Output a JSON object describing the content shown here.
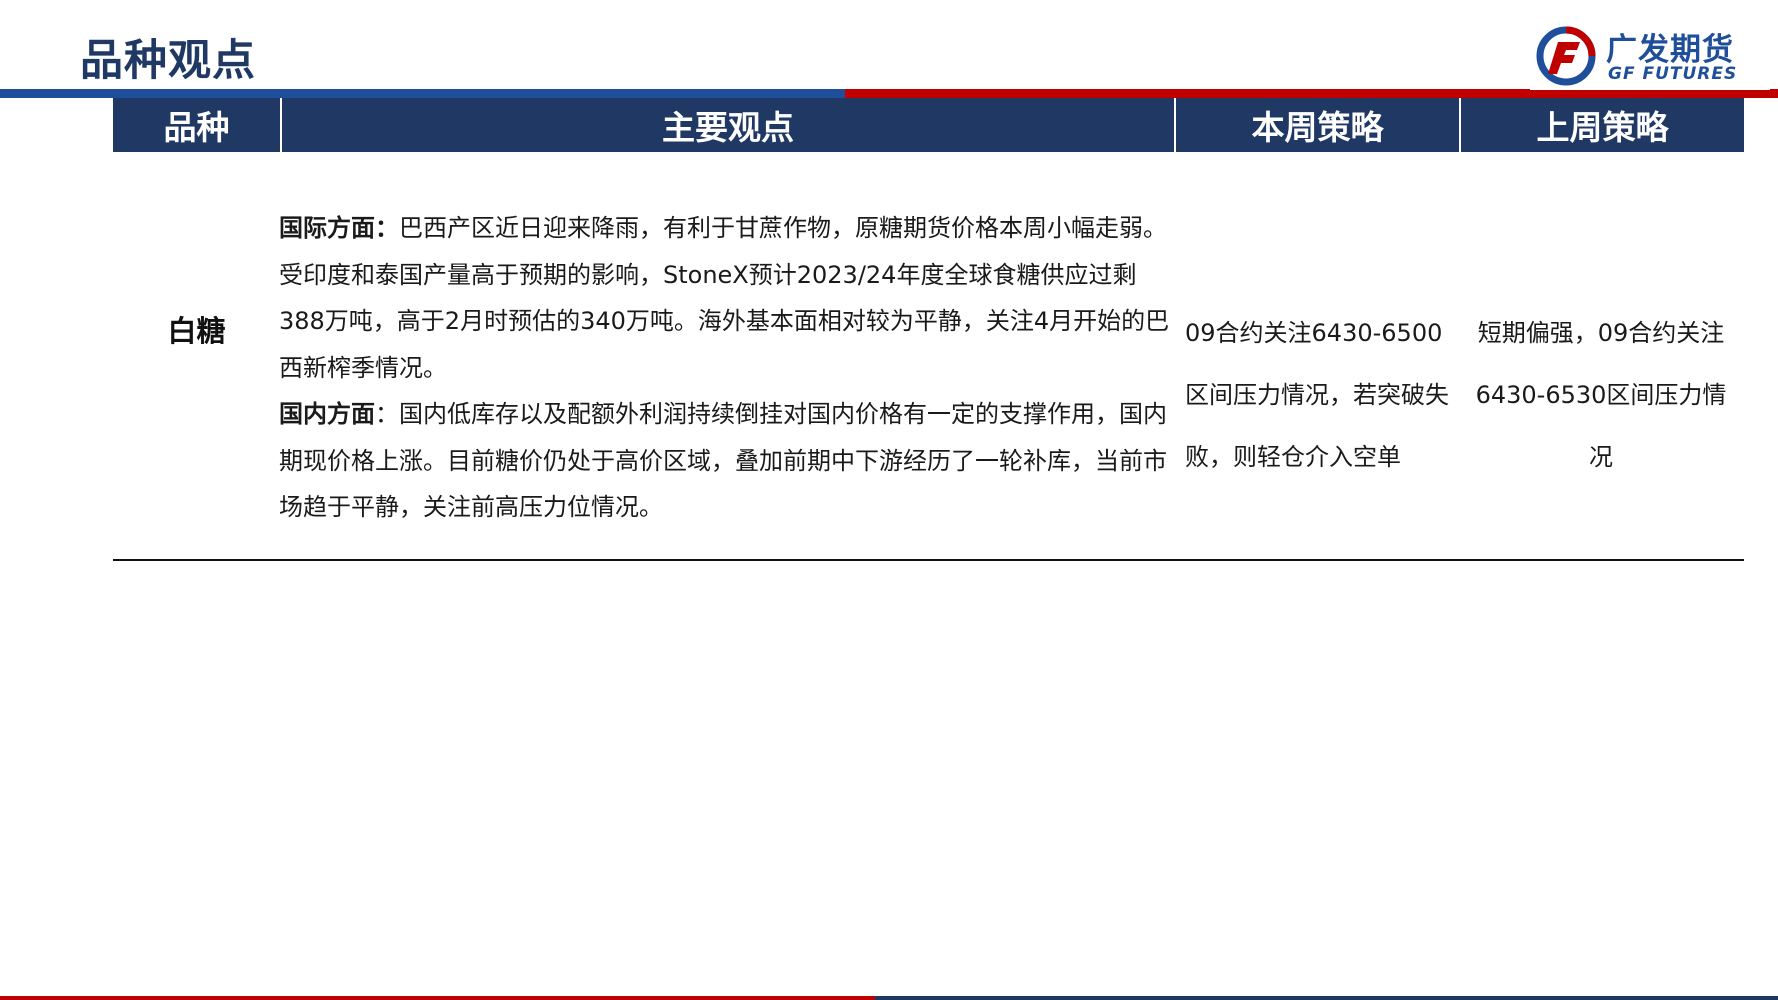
{
  "page": {
    "title": "品种观点"
  },
  "brand": {
    "name_cn": "广发期货",
    "name_en": "GF FUTURES",
    "colors": {
      "navy": "#1f3864",
      "blue": "#1f4e9a",
      "red": "#c00000"
    },
    "icon": "gf-logo-icon"
  },
  "table": {
    "headers": [
      "品种",
      "主要观点",
      "本周策略",
      "上周策略"
    ],
    "rows": [
      {
        "variety": "白糖",
        "views": {
          "international_label": "国际方面：",
          "international_text": "巴西产区近日迎来降雨，有利于甘蔗作物，原糖期货价格本周小幅走弱。受印度和泰国产量高于预期的影响，StoneX预计2023/24年度全球食糖供应过剩388万吨，高于2月时预估的340万吨。海外基本面相对较为平静，关注4月开始的巴西新榨季情况。",
          "domestic_label": "国内方面",
          "domestic_text": "：国内低库存以及配额外利润持续倒挂对国内价格有一定的支撑作用，国内期现价格上涨。目前糖价仍处于高价区域，叠加前期中下游经历了一轮补库，当前市场趋于平静，关注前高压力位情况。"
        },
        "this_week": "09合约关注6430-6500区间压力情况，若突破失败，则轻仓介入空单",
        "last_week": "短期偏强，09合约关注6430-6530区间压力情况"
      }
    ]
  }
}
